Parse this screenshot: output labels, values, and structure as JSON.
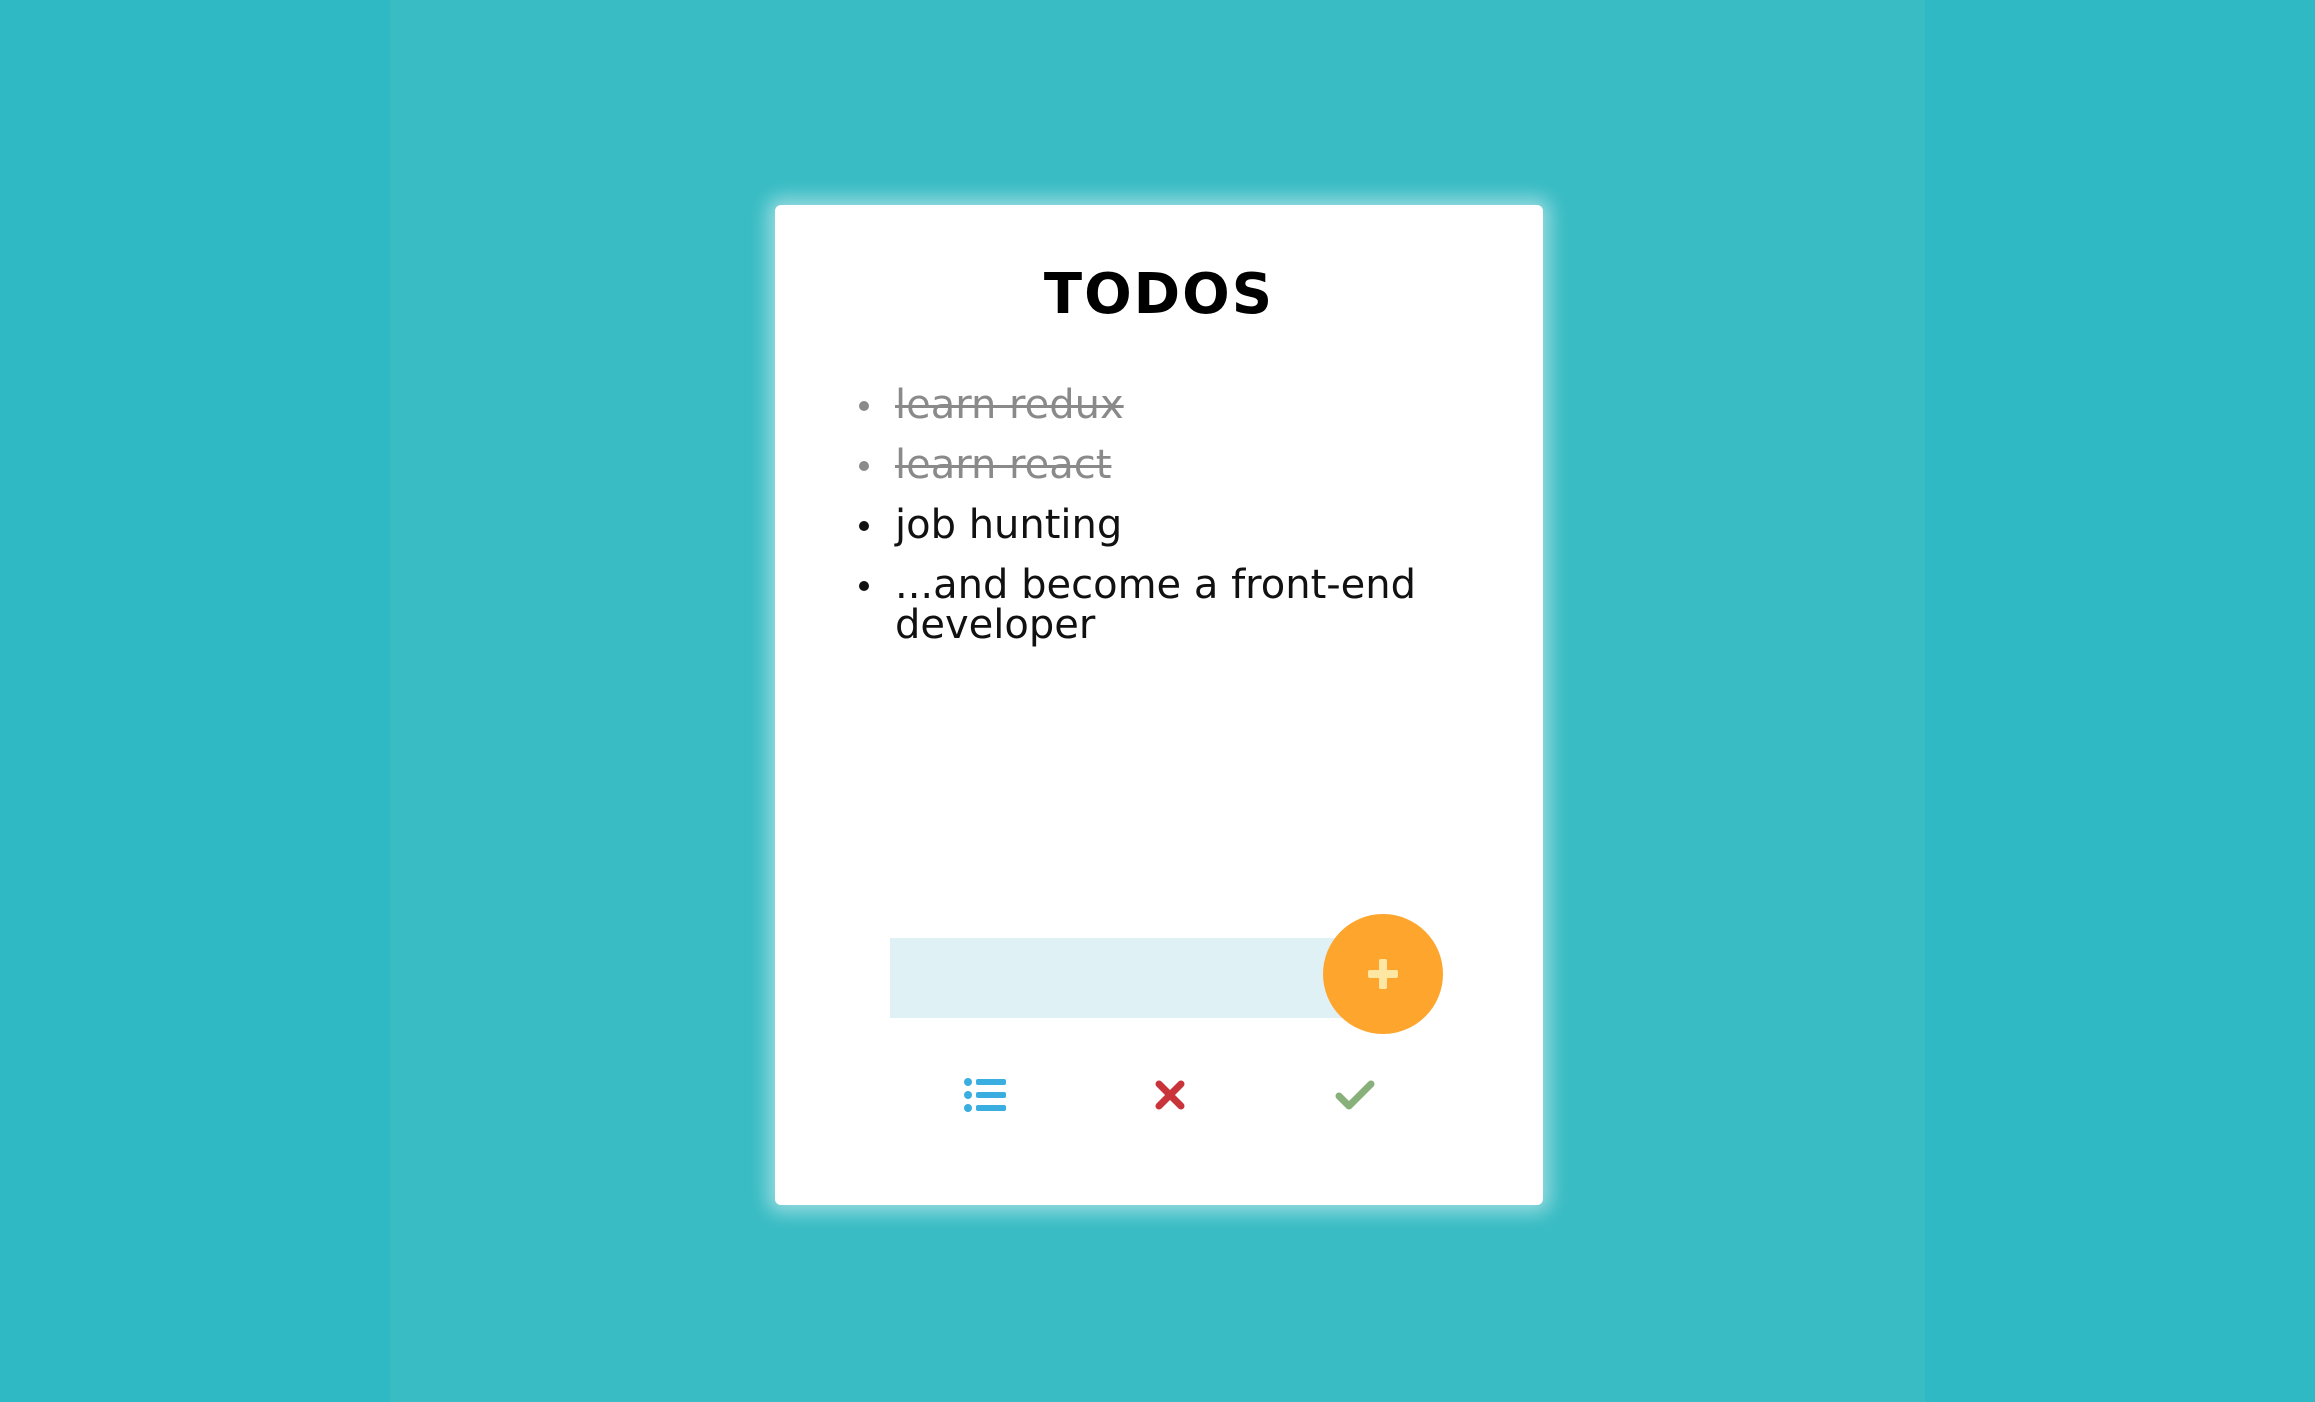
{
  "colors": {
    "background": "#39bcc4",
    "card": "#ffffff",
    "accent_button": "#fea52d",
    "input_bg": "#e0f1f5",
    "list_icon": "#3aaee0",
    "delete_icon": "#c9333a",
    "check_icon": "#88b07a",
    "done_text": "#8a8a8a"
  },
  "app": {
    "title": "TODOS"
  },
  "todos": [
    {
      "text": "learn redux",
      "done": true
    },
    {
      "text": "learn react",
      "done": true
    },
    {
      "text": "job hunting",
      "done": false
    },
    {
      "text": "...and become a front-end developer",
      "done": false
    }
  ],
  "input": {
    "value": "",
    "placeholder": ""
  },
  "add_button": {
    "icon": "plus-icon"
  },
  "filters": [
    {
      "icon": "list-icon",
      "name": "all"
    },
    {
      "icon": "close-icon",
      "name": "active"
    },
    {
      "icon": "check-icon",
      "name": "completed"
    }
  ]
}
